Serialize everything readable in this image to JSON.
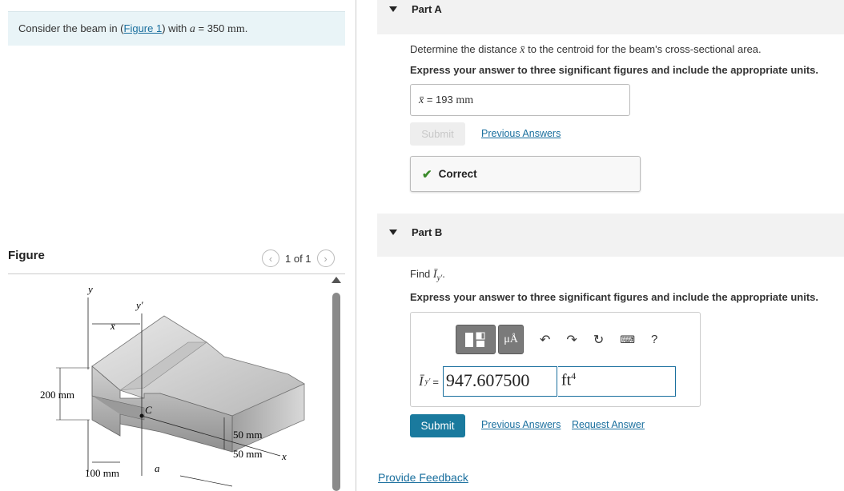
{
  "problem": {
    "intro_prefix": "Consider the beam in (",
    "figure_link": "Figure 1",
    "intro_middle": ") with ",
    "var": "a",
    "intro_eq": " = 350 ",
    "unit": "mm",
    "intro_end": "."
  },
  "figure_panel": {
    "label": "Figure",
    "pager_text": "1 of 1",
    "prev_icon": "chevron-left-icon",
    "next_icon": "chevron-right-icon",
    "labels": {
      "y": "y",
      "y_prime": "y′",
      "x_bar": "x̄",
      "c": "C",
      "x": "x",
      "a": "a",
      "dim_200": "200 mm",
      "dim_100": "100 mm",
      "dim_50a": "50 mm",
      "dim_50b": "50 mm"
    }
  },
  "partA": {
    "title": "Part A",
    "question_prefix": "Determine the distance ",
    "question_var": "x̄",
    "question_suffix": " to the centroid for the beam's cross-sectional area.",
    "instructions": "Express your answer to three significant figures and include the appropriate units.",
    "answer_var": "x̄",
    "answer_eq": " = ",
    "answer_value": "193 ",
    "answer_unit": "mm",
    "submit_label": "Submit",
    "previous_answers": "Previous Answers",
    "status": "Correct"
  },
  "partB": {
    "title": "Part B",
    "question_prefix": "Find ",
    "question_var": "Ī",
    "question_sub": "y′",
    "question_suffix": ".",
    "instructions": "Express your answer to three significant figures and include the appropriate units.",
    "toolbar": {
      "templates_icon": "templates-icon",
      "symbols_label": "μÅ",
      "undo_icon": "undo-icon",
      "redo_icon": "redo-icon",
      "reset_icon": "reset-icon",
      "keyboard_icon": "keyboard-icon",
      "help_label": "?"
    },
    "input_var": "Ī",
    "input_sub": "y′",
    "input_eq": "=",
    "value": "947.607500",
    "unit_base": "ft",
    "unit_exp": "4",
    "submit_label": "Submit",
    "previous_answers": "Previous Answers",
    "request_answer": "Request Answer"
  },
  "footer": {
    "feedback": "Provide Feedback"
  },
  "colors": {
    "link": "#1a6f9e",
    "submit": "#1a7a9e",
    "correct": "#3a8a2a",
    "intro_bg": "#e9f4f7"
  }
}
